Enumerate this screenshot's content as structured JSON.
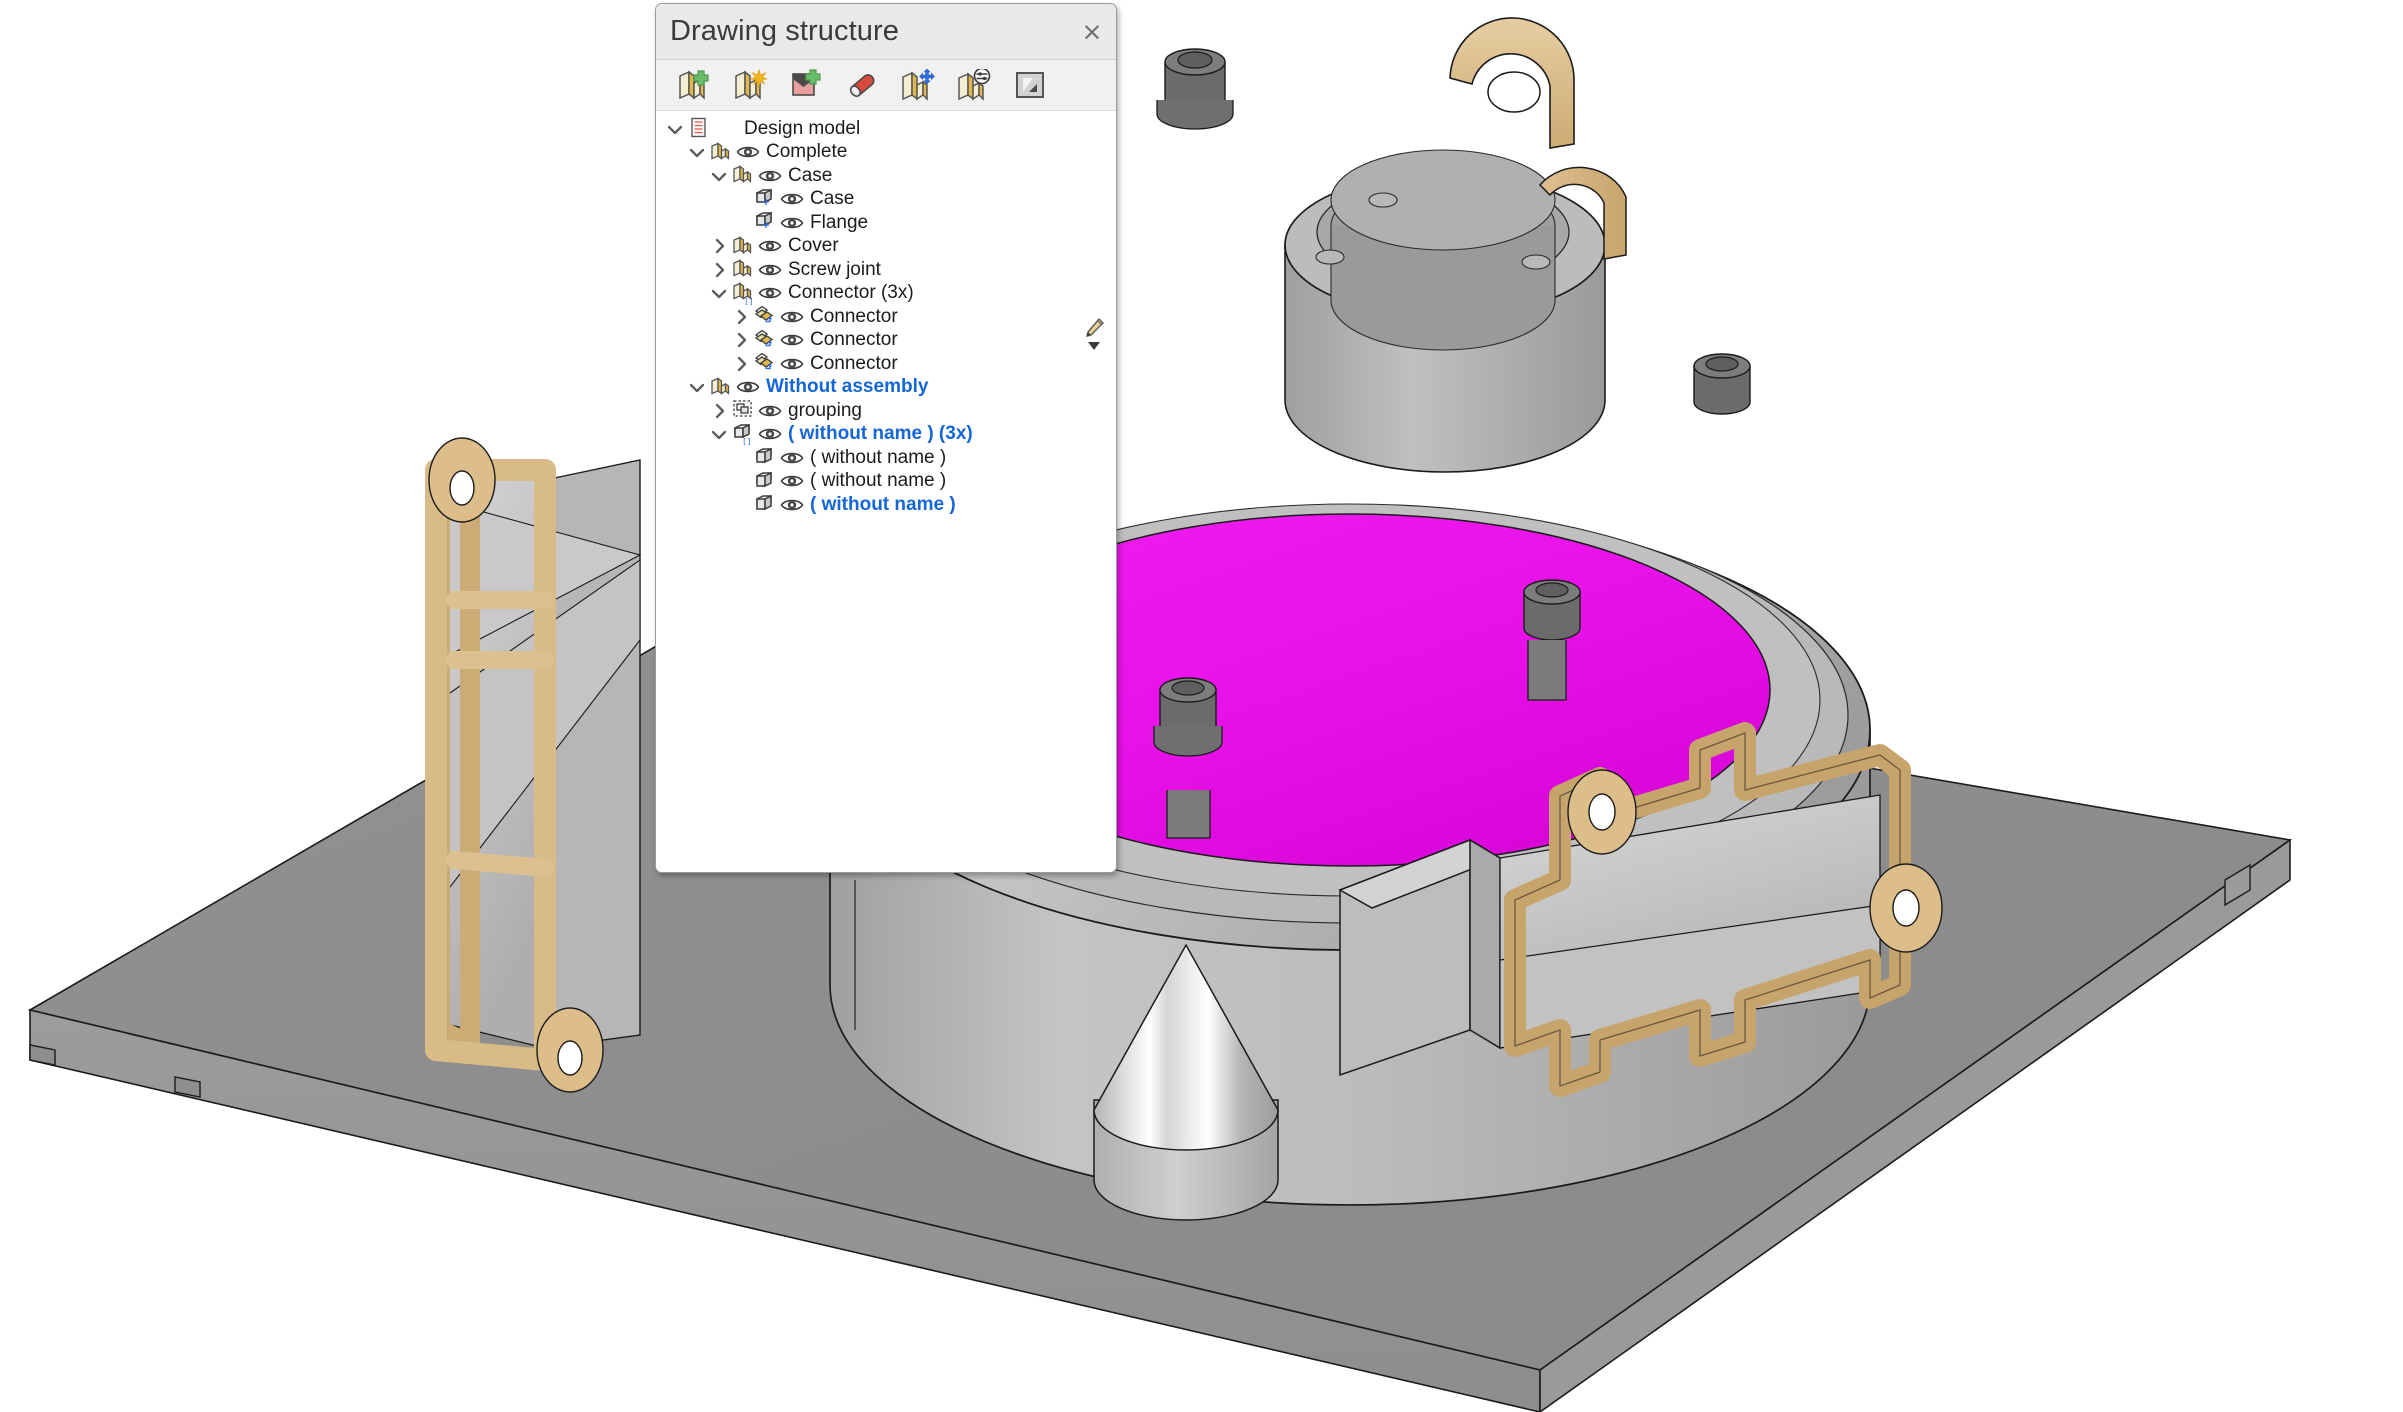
{
  "panel": {
    "title": "Drawing structure",
    "close_label": "×",
    "toolbar": [
      {
        "name": "add-assembly-button",
        "icon": "assembly-plus-icon"
      },
      {
        "name": "new-assembly-button",
        "icon": "assembly-star-icon"
      },
      {
        "name": "add-view-button",
        "icon": "view-plus-icon"
      },
      {
        "name": "delete-button",
        "icon": "eraser-icon"
      },
      {
        "name": "move-assembly-button",
        "icon": "assembly-move-icon"
      },
      {
        "name": "assembly-properties-button",
        "icon": "assembly-settings-icon"
      },
      {
        "name": "shading-toggle-button",
        "icon": "shading-contrast-icon"
      }
    ],
    "edit_icon": "pencil-icon",
    "edit_dropdown_icon": "triangle-down-icon",
    "tree": [
      {
        "label": "Design model",
        "depth": 0,
        "chevron": "down",
        "icon": "document-icon",
        "eye": false,
        "selected": false
      },
      {
        "label": "Complete",
        "depth": 1,
        "chevron": "down",
        "icon": "assembly-icon",
        "eye": true,
        "selected": false
      },
      {
        "label": "Case",
        "depth": 2,
        "chevron": "down",
        "icon": "assembly-icon",
        "eye": true,
        "selected": false
      },
      {
        "label": "Case",
        "depth": 3,
        "chevron": "none",
        "icon": "part-anchor-icon",
        "eye": true,
        "selected": false
      },
      {
        "label": "Flange",
        "depth": 3,
        "chevron": "none",
        "icon": "part-anchor-icon",
        "eye": true,
        "selected": false
      },
      {
        "label": "Cover",
        "depth": 2,
        "chevron": "right",
        "icon": "assembly-icon",
        "eye": true,
        "selected": false
      },
      {
        "label": "Screw joint",
        "depth": 2,
        "chevron": "right",
        "icon": "assembly-icon",
        "eye": true,
        "selected": false
      },
      {
        "label": "Connector (3x)",
        "depth": 2,
        "chevron": "down",
        "icon": "assembly-instance-icon",
        "eye": true,
        "selected": false
      },
      {
        "label": "Connector",
        "depth": 3,
        "chevron": "right",
        "icon": "shape-link-icon",
        "eye": true,
        "selected": false
      },
      {
        "label": "Connector",
        "depth": 3,
        "chevron": "right",
        "icon": "shape-link-icon",
        "eye": true,
        "selected": false
      },
      {
        "label": "Connector",
        "depth": 3,
        "chevron": "right",
        "icon": "shape-link-icon",
        "eye": true,
        "selected": false
      },
      {
        "label": "Without assembly",
        "depth": 1,
        "chevron": "down",
        "icon": "assembly-icon",
        "eye": true,
        "selected": true
      },
      {
        "label": "grouping",
        "depth": 2,
        "chevron": "right",
        "icon": "grouping-icon",
        "eye": true,
        "selected": false
      },
      {
        "label": "( without name ) (3x)",
        "depth": 2,
        "chevron": "down",
        "icon": "part-instance-icon",
        "eye": true,
        "selected": true
      },
      {
        "label": "( without name )",
        "depth": 3,
        "chevron": "none",
        "icon": "part-icon",
        "eye": true,
        "selected": false
      },
      {
        "label": "( without name )",
        "depth": 3,
        "chevron": "none",
        "icon": "part-icon",
        "eye": true,
        "selected": false
      },
      {
        "label": "( without name )",
        "depth": 3,
        "chevron": "none",
        "icon": "part-icon",
        "eye": true,
        "selected": true
      }
    ]
  },
  "viewport": {
    "name": "3d-cad-viewport",
    "background": "#ffffff",
    "selection_color": "#ee11ee",
    "base_plate_color": "#8c8c8c",
    "body_color": "#b4b4b4",
    "connector_color": "#ddbe8a",
    "bolt_color": "#6e6e6e",
    "marker": "selection-origin-marker",
    "objects": [
      "base-plate",
      "vessel-case",
      "vessel-cover",
      "nozzle-flange",
      "lifting-lug",
      "cone-pin",
      "connector-left",
      "connector-right",
      "bolt-ring"
    ]
  }
}
